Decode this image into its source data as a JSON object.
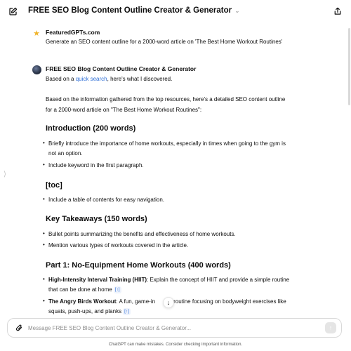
{
  "header": {
    "title": "FREE SEO Blog Content Outline Creator & Generator",
    "chevron": "⌄"
  },
  "user_message": {
    "name": "FeaturedGPTs.com",
    "text": "Generate an SEO content outline for a 2000-word article on 'The Best Home Workout Routines'"
  },
  "assistant": {
    "name": "FREE SEO Blog Content Outline Creator & Generator",
    "search_prefix": "Based on a ",
    "search_link": "quick search",
    "search_suffix": ", here's what I discovered.",
    "intro_line1": "Based on the information gathered from the top resources, here's a detailed SEO content outline",
    "intro_line2": "for a 2000-word article on \"The Best Home Workout Routines\":",
    "sections": {
      "introduction": {
        "heading": "Introduction (200 words)",
        "b1_line1": "Briefly introduce the importance of home workouts, especially in times when going to the gym is",
        "b1_line2": "not an option.",
        "b2": "Include keyword in the first paragraph."
      },
      "toc": {
        "heading": "[toc]",
        "b1": "Include a table of contents for easy navigation."
      },
      "takeaways": {
        "heading": "Key Takeaways (150 words)",
        "b1": "Bullet points summarizing the benefits and effectiveness of home workouts.",
        "b2": "Mention various types of workouts covered in the article."
      },
      "part1": {
        "heading": "Part 1: No-Equipment Home Workouts (400 words)",
        "b1_bold": "High-Intensity Interval Training (HIIT)",
        "b1_rest": ": Explain the concept of HIIT and provide a simple routine",
        "b1_line2": "that can be done at home",
        "b2_bold": "The Angry Birds Workout",
        "b2_rest": ": A fun, game-in",
        "b2_rest2": "ed routine focusing on bodyweight exercises like",
        "b2_line2": "squats, push-ups, and planks",
        "cite": "[↑]"
      }
    }
  },
  "composer": {
    "placeholder": "Message FREE SEO Blog Content Outline Creator & Generator..."
  },
  "footer": {
    "disclaimer": "ChatGPT can make mistakes. Consider checking important information."
  }
}
